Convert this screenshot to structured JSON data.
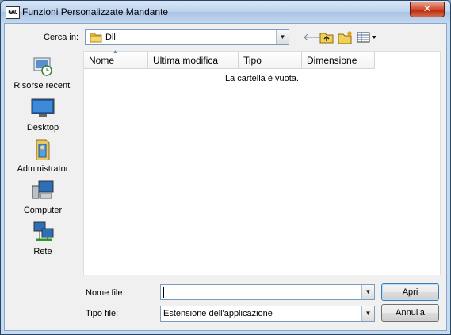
{
  "window": {
    "title": "Funzioni Personalizzate Mandante",
    "app_icon_text": "GAC"
  },
  "look_in": {
    "label": "Cerca in:",
    "value": "Dll",
    "icon": "folder-icon"
  },
  "toolbar": {
    "back": "back-arrow-icon",
    "up": "up-folder-icon",
    "new_folder": "new-folder-icon",
    "views": "views-menu-icon"
  },
  "places": [
    {
      "label": "Risorse recenti",
      "icon": "recent-places-icon"
    },
    {
      "label": "Desktop",
      "icon": "desktop-icon"
    },
    {
      "label": "Administrator",
      "icon": "user-folder-icon"
    },
    {
      "label": "Computer",
      "icon": "computer-icon"
    },
    {
      "label": "Rete",
      "icon": "network-icon"
    }
  ],
  "columns": [
    "Nome",
    "Ultima modifica",
    "Tipo",
    "Dimensione"
  ],
  "empty_message": "La cartella è vuota.",
  "file_name": {
    "label": "Nome file:",
    "value": ""
  },
  "file_type": {
    "label": "Tipo file:",
    "value": "Estensione dell'applicazione"
  },
  "buttons": {
    "open": "Apri",
    "cancel": "Annulla"
  }
}
